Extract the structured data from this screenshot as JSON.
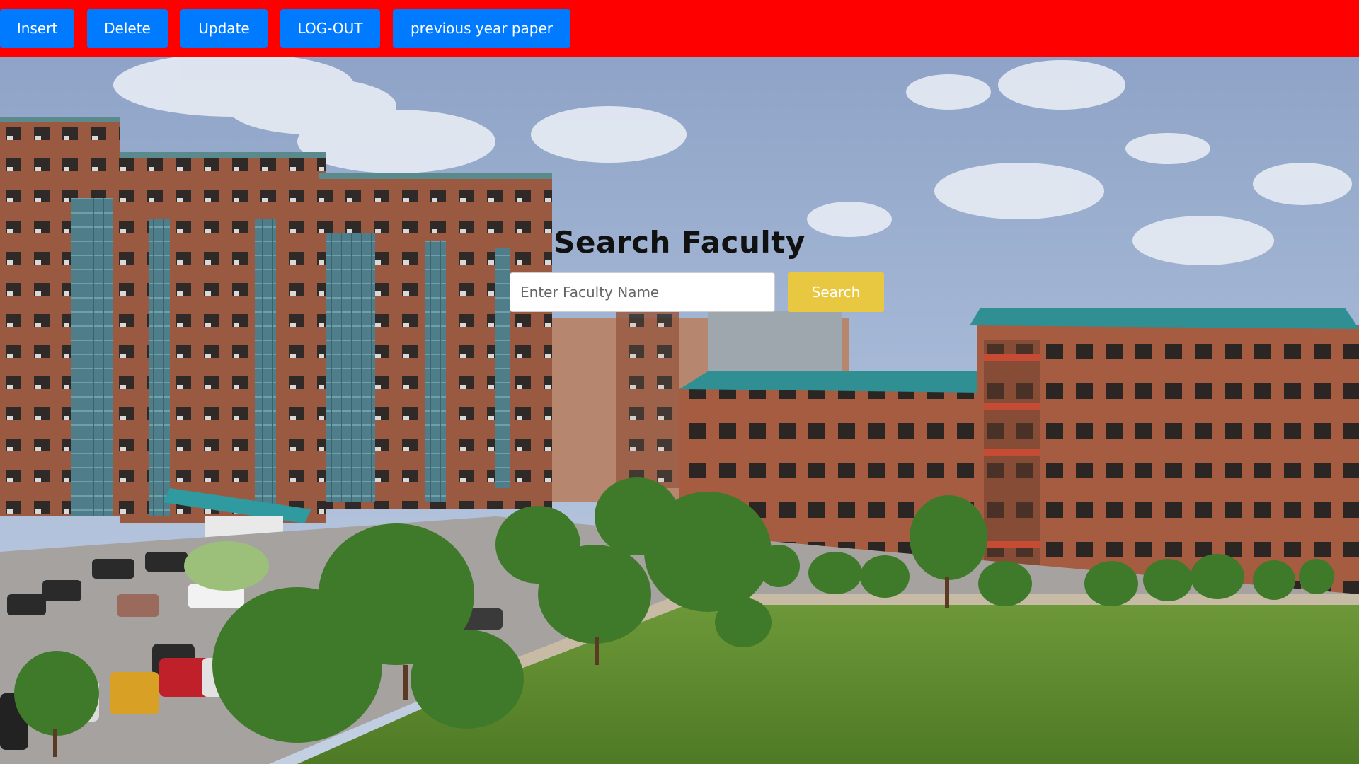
{
  "navbar": {
    "background": "#ff0000",
    "button_color": "#007bff",
    "buttons": [
      {
        "label": "Insert"
      },
      {
        "label": "Delete"
      },
      {
        "label": "Update"
      },
      {
        "label": "LOG-OUT"
      },
      {
        "label": "previous year paper"
      }
    ]
  },
  "search": {
    "title": "Search Faculty",
    "input_placeholder": "Enter Faculty Name",
    "input_value": "",
    "button_label": "Search",
    "button_color": "#e8c840"
  },
  "hero": {
    "image_icon": "campus-photo-icon"
  }
}
